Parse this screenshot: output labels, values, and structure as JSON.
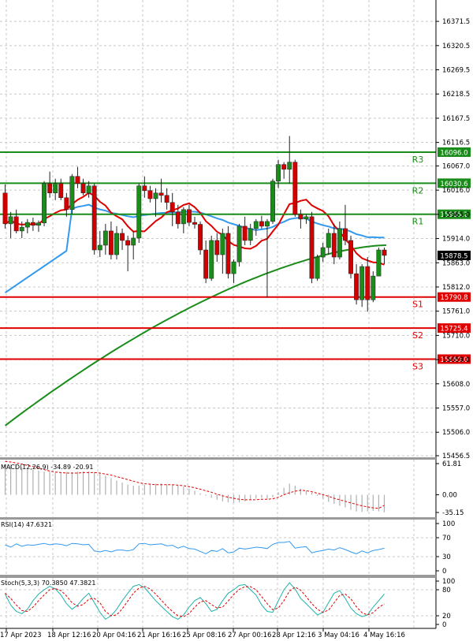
{
  "chart_data": [
    {
      "type": "candlestick",
      "panel": "price",
      "ylim": [
        15456.5,
        16380
      ],
      "y_ticks": [
        "16371.5",
        "16320.5",
        "16269.5",
        "16218.5",
        "16167.5",
        "16116.5",
        "16067.0",
        "16016.0",
        "15965.0",
        "15914.0",
        "15863.0",
        "15812.0",
        "15761.0",
        "15710.0",
        "15659.0",
        "15608.0",
        "15557.0",
        "15506.0",
        "15456.5"
      ],
      "x_ticks": [
        "17 Apr 2023",
        "18 Apr 12:16",
        "20 Apr 04:16",
        "21 Apr 16:16",
        "25 Apr 08:16",
        "27 Apr 00:16",
        "28 Apr 12:16",
        "3 May 04:16",
        "4 May 16:16"
      ],
      "last_price": 15878.5,
      "levels": [
        {
          "label": "R3",
          "value": 16096.0,
          "value_label": "16096.0",
          "kind": "resistance",
          "color": "#1a8c1a"
        },
        {
          "label": "R2",
          "value": 16030.6,
          "value_label": "16030.6",
          "kind": "resistance",
          "color": "#1a8c1a"
        },
        {
          "label": "R1",
          "value": 15965.2,
          "value_label": "15965.2",
          "kind": "resistance",
          "color": "#1a8c1a"
        },
        {
          "label": "S1",
          "value": 15790.8,
          "value_label": "15790.8",
          "kind": "support",
          "color": "#e00000"
        },
        {
          "label": "S2",
          "value": 15725.4,
          "value_label": "15725.4",
          "kind": "support",
          "color": "#e00000"
        },
        {
          "label": "S3",
          "value": 15660.0,
          "value_label": "15660.0",
          "kind": "support",
          "color": "#e00000"
        }
      ],
      "candles": [
        [
          16010,
          16028,
          15935,
          15945
        ],
        [
          15945,
          15970,
          15915,
          15960
        ],
        [
          15960,
          15975,
          15925,
          15930
        ],
        [
          15930,
          15950,
          15915,
          15938
        ],
        [
          15938,
          15955,
          15925,
          15948
        ],
        [
          15948,
          15958,
          15930,
          15942
        ],
        [
          15942,
          15952,
          15928,
          15947
        ],
        [
          15947,
          16035,
          15940,
          16030
        ],
        [
          16030,
          16055,
          16000,
          16010
        ],
        [
          16010,
          16040,
          15995,
          16030
        ],
        [
          16030,
          16040,
          15995,
          16000
        ],
        [
          16000,
          16010,
          15960,
          15975
        ],
        [
          15975,
          16050,
          15965,
          16045
        ],
        [
          16045,
          16065,
          16020,
          16030
        ],
        [
          16030,
          16040,
          16005,
          16010
        ],
        [
          16010,
          16035,
          16000,
          16025
        ],
        [
          16025,
          16030,
          15880,
          15890
        ],
        [
          15890,
          15930,
          15875,
          15900
        ],
        [
          15900,
          15945,
          15880,
          15930
        ],
        [
          15930,
          15950,
          15870,
          15880
        ],
        [
          15880,
          15940,
          15870,
          15925
        ],
        [
          15925,
          15935,
          15890,
          15910
        ],
        [
          15910,
          15920,
          15845,
          15900
        ],
        [
          15900,
          15930,
          15870,
          15915
        ],
        [
          15915,
          16030,
          15905,
          16025
        ],
        [
          16025,
          16045,
          16000,
          16015
        ],
        [
          16015,
          16025,
          15990,
          15998
        ],
        [
          15998,
          16020,
          15960,
          16010
        ],
        [
          16010,
          16040,
          15990,
          16005
        ],
        [
          16005,
          16020,
          15975,
          15990
        ],
        [
          15990,
          16010,
          15940,
          15970
        ],
        [
          15970,
          15985,
          15935,
          15945
        ],
        [
          15945,
          15980,
          15925,
          15975
        ],
        [
          15975,
          15985,
          15940,
          15948
        ],
        [
          15948,
          15960,
          15935,
          15944
        ],
        [
          15944,
          15950,
          15880,
          15890
        ],
        [
          15890,
          15910,
          15820,
          15830
        ],
        [
          15830,
          15920,
          15825,
          15910
        ],
        [
          15910,
          15925,
          15865,
          15880
        ],
        [
          15880,
          15935,
          15840,
          15925
        ],
        [
          15925,
          15940,
          15830,
          15840
        ],
        [
          15840,
          15870,
          15820,
          15865
        ],
        [
          15865,
          15945,
          15855,
          15940
        ],
        [
          15940,
          15960,
          15900,
          15910
        ],
        [
          15910,
          15945,
          15900,
          15935
        ],
        [
          15935,
          15955,
          15920,
          15950
        ],
        [
          15950,
          15962,
          15935,
          15940
        ],
        [
          15940,
          15955,
          15790,
          15950
        ],
        [
          15950,
          16040,
          15945,
          16035
        ],
        [
          16035,
          16080,
          16020,
          16070
        ],
        [
          16070,
          16075,
          16040,
          16060
        ],
        [
          16060,
          16130,
          16030,
          16075
        ],
        [
          16075,
          16080,
          15960,
          15965
        ],
        [
          15965,
          15975,
          15935,
          15955
        ],
        [
          15955,
          15965,
          15945,
          15960
        ],
        [
          15960,
          15970,
          15820,
          15830
        ],
        [
          15830,
          15880,
          15825,
          15875
        ],
        [
          15875,
          15905,
          15865,
          15895
        ],
        [
          15895,
          15935,
          15880,
          15925
        ],
        [
          15925,
          15945,
          15860,
          15875
        ],
        [
          15875,
          15950,
          15870,
          15935
        ],
        [
          15935,
          15985,
          15900,
          15910
        ],
        [
          15910,
          15920,
          15830,
          15840
        ],
        [
          15840,
          15860,
          15775,
          15785
        ],
        [
          15785,
          15860,
          15770,
          15855
        ],
        [
          15855,
          15875,
          15760,
          15785
        ],
        [
          15785,
          15845,
          15780,
          15835
        ],
        [
          15835,
          15895,
          15860,
          15890
        ],
        [
          15890,
          15895,
          15860,
          15878.5
        ]
      ]
    },
    {
      "type": "histogram+line",
      "panel": "macd",
      "label": "MACD(12,26,9) -34.89 -20.91",
      "y_ticks": [
        "61.81",
        "0.00",
        "-35.15"
      ],
      "ylim": [
        -35.15,
        61.81
      ],
      "histogram": [
        60,
        60,
        58,
        55,
        52,
        50,
        48,
        46,
        45,
        44,
        44,
        45,
        45,
        46,
        46,
        46,
        45,
        42,
        38,
        33,
        28,
        24,
        20,
        18,
        18,
        20,
        21,
        22,
        22,
        21,
        20,
        18,
        16,
        12,
        8,
        3,
        -2,
        -6,
        -10,
        -13,
        -15,
        -16,
        -15,
        -13,
        -10,
        -8,
        -6,
        -8,
        -5,
        5,
        14,
        22,
        18,
        12,
        8,
        4,
        -2,
        -8,
        -14,
        -18,
        -22,
        -25,
        -30,
        -33,
        -34,
        -33,
        -32,
        -33,
        -34.89
      ],
      "signal": [
        66,
        65,
        63,
        61,
        58,
        56,
        53,
        50,
        47,
        45,
        44,
        43,
        43,
        43,
        44,
        44,
        44,
        43,
        41,
        39,
        36,
        33,
        30,
        27,
        24,
        22,
        21,
        20,
        20,
        20,
        20,
        19,
        18,
        16,
        14,
        11,
        8,
        5,
        1,
        -2,
        -5,
        -7,
        -9,
        -10,
        -10,
        -10,
        -9,
        -9,
        -8,
        -5,
        0,
        4,
        7,
        9,
        8,
        6,
        3,
        0,
        -3,
        -7,
        -10,
        -13,
        -16,
        -19,
        -22,
        -24,
        -26,
        -27,
        -20.91
      ]
    },
    {
      "type": "line",
      "panel": "rsi",
      "label": "RSI(14) 47.6321",
      "y_ticks": [
        "100",
        "70",
        "30",
        "0"
      ],
      "ylim": [
        0,
        100
      ],
      "values": [
        55,
        50,
        57,
        52,
        55,
        54,
        56,
        58,
        55,
        57,
        56,
        53,
        58,
        57,
        55,
        56,
        42,
        40,
        43,
        40,
        44,
        44,
        42,
        45,
        57,
        58,
        55,
        56,
        57,
        53,
        54,
        48,
        52,
        47,
        46,
        41,
        36,
        43,
        41,
        47,
        38,
        40,
        48,
        46,
        48,
        50,
        49,
        47,
        56,
        60,
        60,
        62,
        48,
        50,
        51,
        38,
        41,
        43,
        46,
        44,
        49,
        45,
        40,
        36,
        42,
        38,
        43,
        45,
        47.6321
      ]
    },
    {
      "type": "line",
      "panel": "stochastic",
      "label": "Stoch(5,3,3) 70.3850 47.3821",
      "y_ticks": [
        "100",
        "80",
        "20",
        "0"
      ],
      "ylim": [
        0,
        100
      ],
      "k": [
        70,
        45,
        30,
        25,
        35,
        55,
        70,
        80,
        88,
        82,
        68,
        48,
        35,
        45,
        60,
        72,
        50,
        28,
        12,
        20,
        35,
        55,
        72,
        88,
        92,
        85,
        70,
        55,
        42,
        30,
        18,
        12,
        22,
        40,
        55,
        62,
        48,
        30,
        35,
        55,
        72,
        80,
        90,
        92,
        80,
        68,
        45,
        30,
        28,
        55,
        80,
        96,
        82,
        60,
        48,
        35,
        22,
        28,
        50,
        72,
        78,
        60,
        38,
        25,
        18,
        22,
        40,
        55,
        70.385
      ],
      "d": [
        72,
        60,
        45,
        32,
        30,
        40,
        55,
        68,
        80,
        83,
        78,
        66,
        50,
        42,
        46,
        58,
        60,
        50,
        30,
        20,
        22,
        36,
        54,
        72,
        84,
        88,
        82,
        70,
        56,
        42,
        30,
        20,
        18,
        25,
        40,
        52,
        55,
        46,
        38,
        40,
        54,
        69,
        81,
        87,
        87,
        80,
        64,
        48,
        34,
        38,
        55,
        77,
        86,
        79,
        64,
        48,
        35,
        28,
        33,
        50,
        67,
        70,
        59,
        41,
        27,
        22,
        27,
        39,
        47.3821
      ]
    }
  ]
}
